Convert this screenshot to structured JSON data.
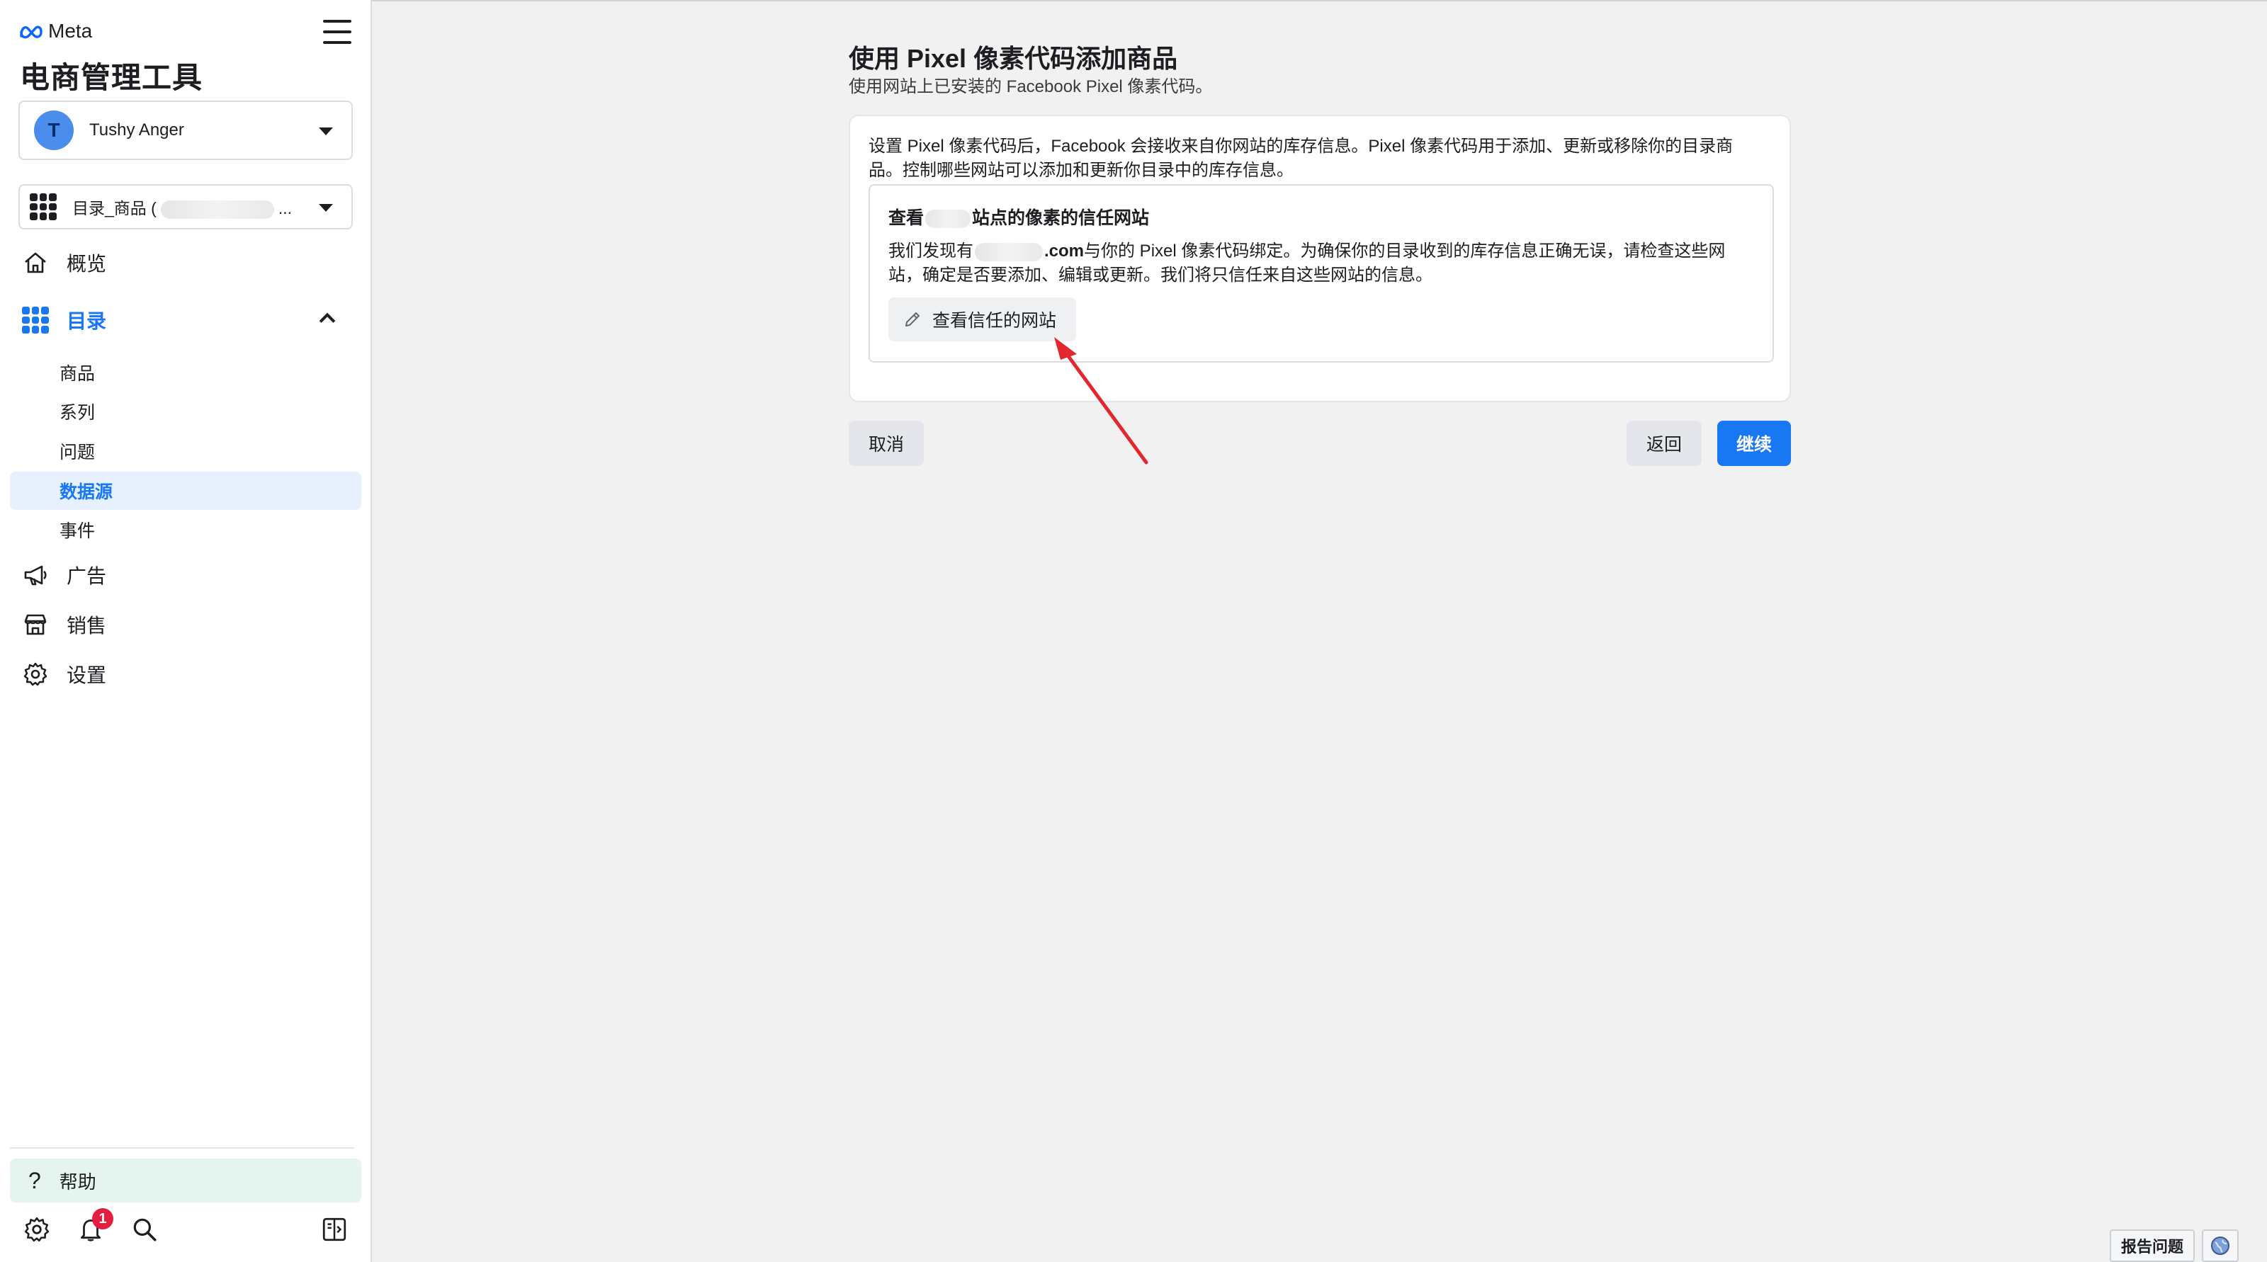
{
  "sidebar": {
    "brand": "Meta",
    "app_title": "电商管理工具",
    "account": {
      "initial": "T",
      "name": "Tushy Anger"
    },
    "catalog": {
      "label_prefix": "目录_商品 (",
      "label_suffix": "..."
    },
    "nav": {
      "overview": "概览",
      "catalog": "目录",
      "catalog_sub": [
        "商品",
        "系列",
        "问题",
        "数据源",
        "事件"
      ],
      "ads": "广告",
      "sales": "销售",
      "settings": "设置"
    },
    "help": "帮助",
    "notification_count": "1"
  },
  "main": {
    "title": "使用 Pixel 像素代码添加商品",
    "subtitle": "使用网站上已安装的 Facebook Pixel 像素代码。",
    "intro": "设置 Pixel 像素代码后，Facebook 会接收来自你网站的库存信息。Pixel 像素代码用于添加、更新或移除你的目录商品。控制哪些网站可以添加和更新你目录中的库存信息。",
    "trusted": {
      "title_prefix": "查看",
      "title_suffix": "站点的像素的信任网站",
      "desc_prefix": "我们发现有",
      "desc_domain": ".com",
      "desc_suffix": "与你的 Pixel 像素代码绑定。为确保你的目录收到的库存信息正确无误，请检查这些网站，确定是否要添加、编辑或更新。我们将只信任来自这些网站的信息。",
      "button": "查看信任的网站"
    },
    "buttons": {
      "cancel": "取消",
      "back": "返回",
      "continue": "继续"
    }
  },
  "footer": {
    "report": "报告问题"
  },
  "colors": {
    "accent": "#1877f2",
    "annotation_arrow": "#e0282e",
    "selected_bg": "#e7f0fd",
    "help_bg": "#e6f4ef"
  },
  "icons": [
    "meta-logo-icon",
    "hamburger-icon",
    "grid-icon",
    "home-icon",
    "megaphone-icon",
    "store-icon",
    "gear-icon",
    "question-icon",
    "bell-icon",
    "search-icon",
    "panel-toggle-icon",
    "pencil-icon",
    "globe-icon"
  ]
}
